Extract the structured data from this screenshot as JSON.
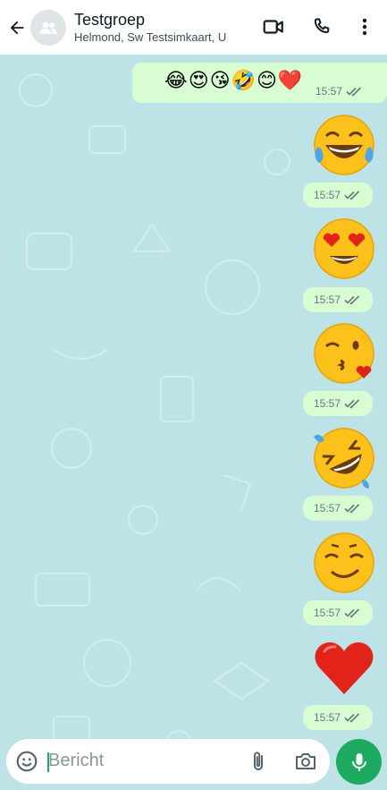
{
  "header": {
    "title": "Testgroep",
    "subtitle": "Helmond, Sw Testsimkaart, U",
    "icons": [
      "back-arrow-icon",
      "group-avatar-icon",
      "video-call-icon",
      "voice-call-icon",
      "more-options-icon"
    ]
  },
  "messages": {
    "text_message": {
      "content": "😂😍😘🤣😊❤️",
      "time": "15:57"
    },
    "emoji_messages": [
      {
        "emoji": "face-with-tears-of-joy",
        "time": "15:57"
      },
      {
        "emoji": "smiling-face-with-heart-eyes",
        "time": "15:57"
      },
      {
        "emoji": "face-blowing-a-kiss",
        "time": "15:57"
      },
      {
        "emoji": "rolling-on-the-floor-laughing",
        "time": "15:57"
      },
      {
        "emoji": "smiling-face-with-smiling-eyes",
        "time": "15:57"
      },
      {
        "emoji": "red-heart",
        "time": "15:57"
      }
    ]
  },
  "composer": {
    "placeholder": "Bericht",
    "icons": [
      "emoji-icon",
      "attach-icon",
      "camera-icon",
      "mic-icon"
    ]
  },
  "colors": {
    "chat_background": "#bde3e6",
    "outgoing_bubble": "#d9fdd3",
    "mic_button": "#1daa61",
    "read_tick": "#667781"
  }
}
